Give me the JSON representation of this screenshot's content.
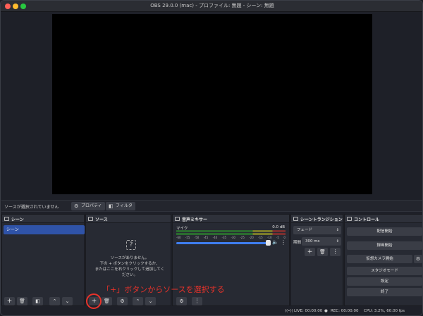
{
  "window": {
    "title": "OBS 29.0.0 (mac) - プロファイル: 無題 - シーン: 無題"
  },
  "status_strip": {
    "no_source_text": "ソースが選択されていません",
    "properties_label": "プロパティ",
    "filters_label": "フィルタ"
  },
  "docks": {
    "scenes": {
      "title": "シーン",
      "items": [
        "シーン"
      ]
    },
    "sources": {
      "title": "ソース",
      "empty_text": [
        "ソースがありません。",
        "下の + ボタンをクリックするか、",
        "またはここを右クリックして追加してく",
        "ださい。"
      ]
    },
    "mixer": {
      "title": "音声ミキサー",
      "channel_label": "マイク",
      "level_db": "0.0 dB",
      "ticks": [
        "-60",
        "-55",
        "-50",
        "-45",
        "-40",
        "-35",
        "-30",
        "-25",
        "-20",
        "-15",
        "-10",
        "-5",
        "0"
      ]
    },
    "transitions": {
      "title": "シーントランジション",
      "transition": "フェード",
      "duration_label": "期間",
      "duration_value": "300 ms"
    },
    "controls": {
      "title": "コントロール",
      "buttons": [
        "配信開始",
        "録画開始",
        "仮想カメラ開始",
        "スタジオモード",
        "設定",
        "終了"
      ]
    }
  },
  "status_bar": {
    "live": "LIVE: 00:00:00",
    "rec": "REC: 00:00:00",
    "cpu": "CPU: 3.2%, 60.00 fps"
  },
  "annotation": {
    "text": "「+」ボタンからソースを選択する"
  },
  "colors": {
    "accent": "#2f53a8",
    "annotation": "#e8322a"
  }
}
